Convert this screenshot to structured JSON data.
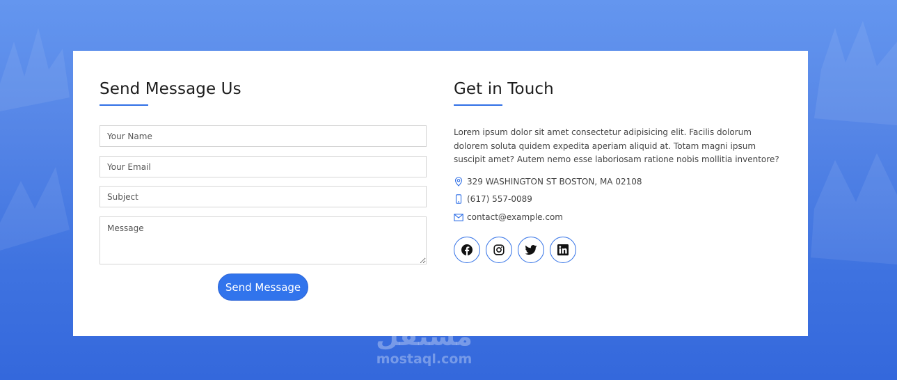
{
  "contact_form": {
    "title": "Send Message Us",
    "name_placeholder": "Your Name",
    "email_placeholder": "Your Email",
    "subject_placeholder": "Subject",
    "message_placeholder": "Message",
    "send_label": "Send Message"
  },
  "get_in_touch": {
    "title": "Get in Touch",
    "intro": "Lorem ipsum dolor sit amet consectetur adipisicing elit. Facilis dolorum dolorem soluta quidem expedita aperiam aliquid at. Totam magni ipsum suscipit amet? Autem nemo esse laboriosam ratione nobis mollitia inventore?",
    "address": "329 WASHINGTON ST BOSTON, MA 02108",
    "phone": "(617) 557-0089",
    "email": "contact@example.com",
    "social": [
      {
        "icon": "facebook-icon"
      },
      {
        "icon": "instagram-icon"
      },
      {
        "icon": "twitter-icon"
      },
      {
        "icon": "linkedin-icon"
      }
    ]
  },
  "watermark": {
    "logo": "مستقل",
    "text": "mostaql.com"
  },
  "colors": {
    "accent": "#2f6fe6",
    "button": "#3174ec",
    "background_top": "#6496ef",
    "background_bottom": "#3468dc"
  }
}
